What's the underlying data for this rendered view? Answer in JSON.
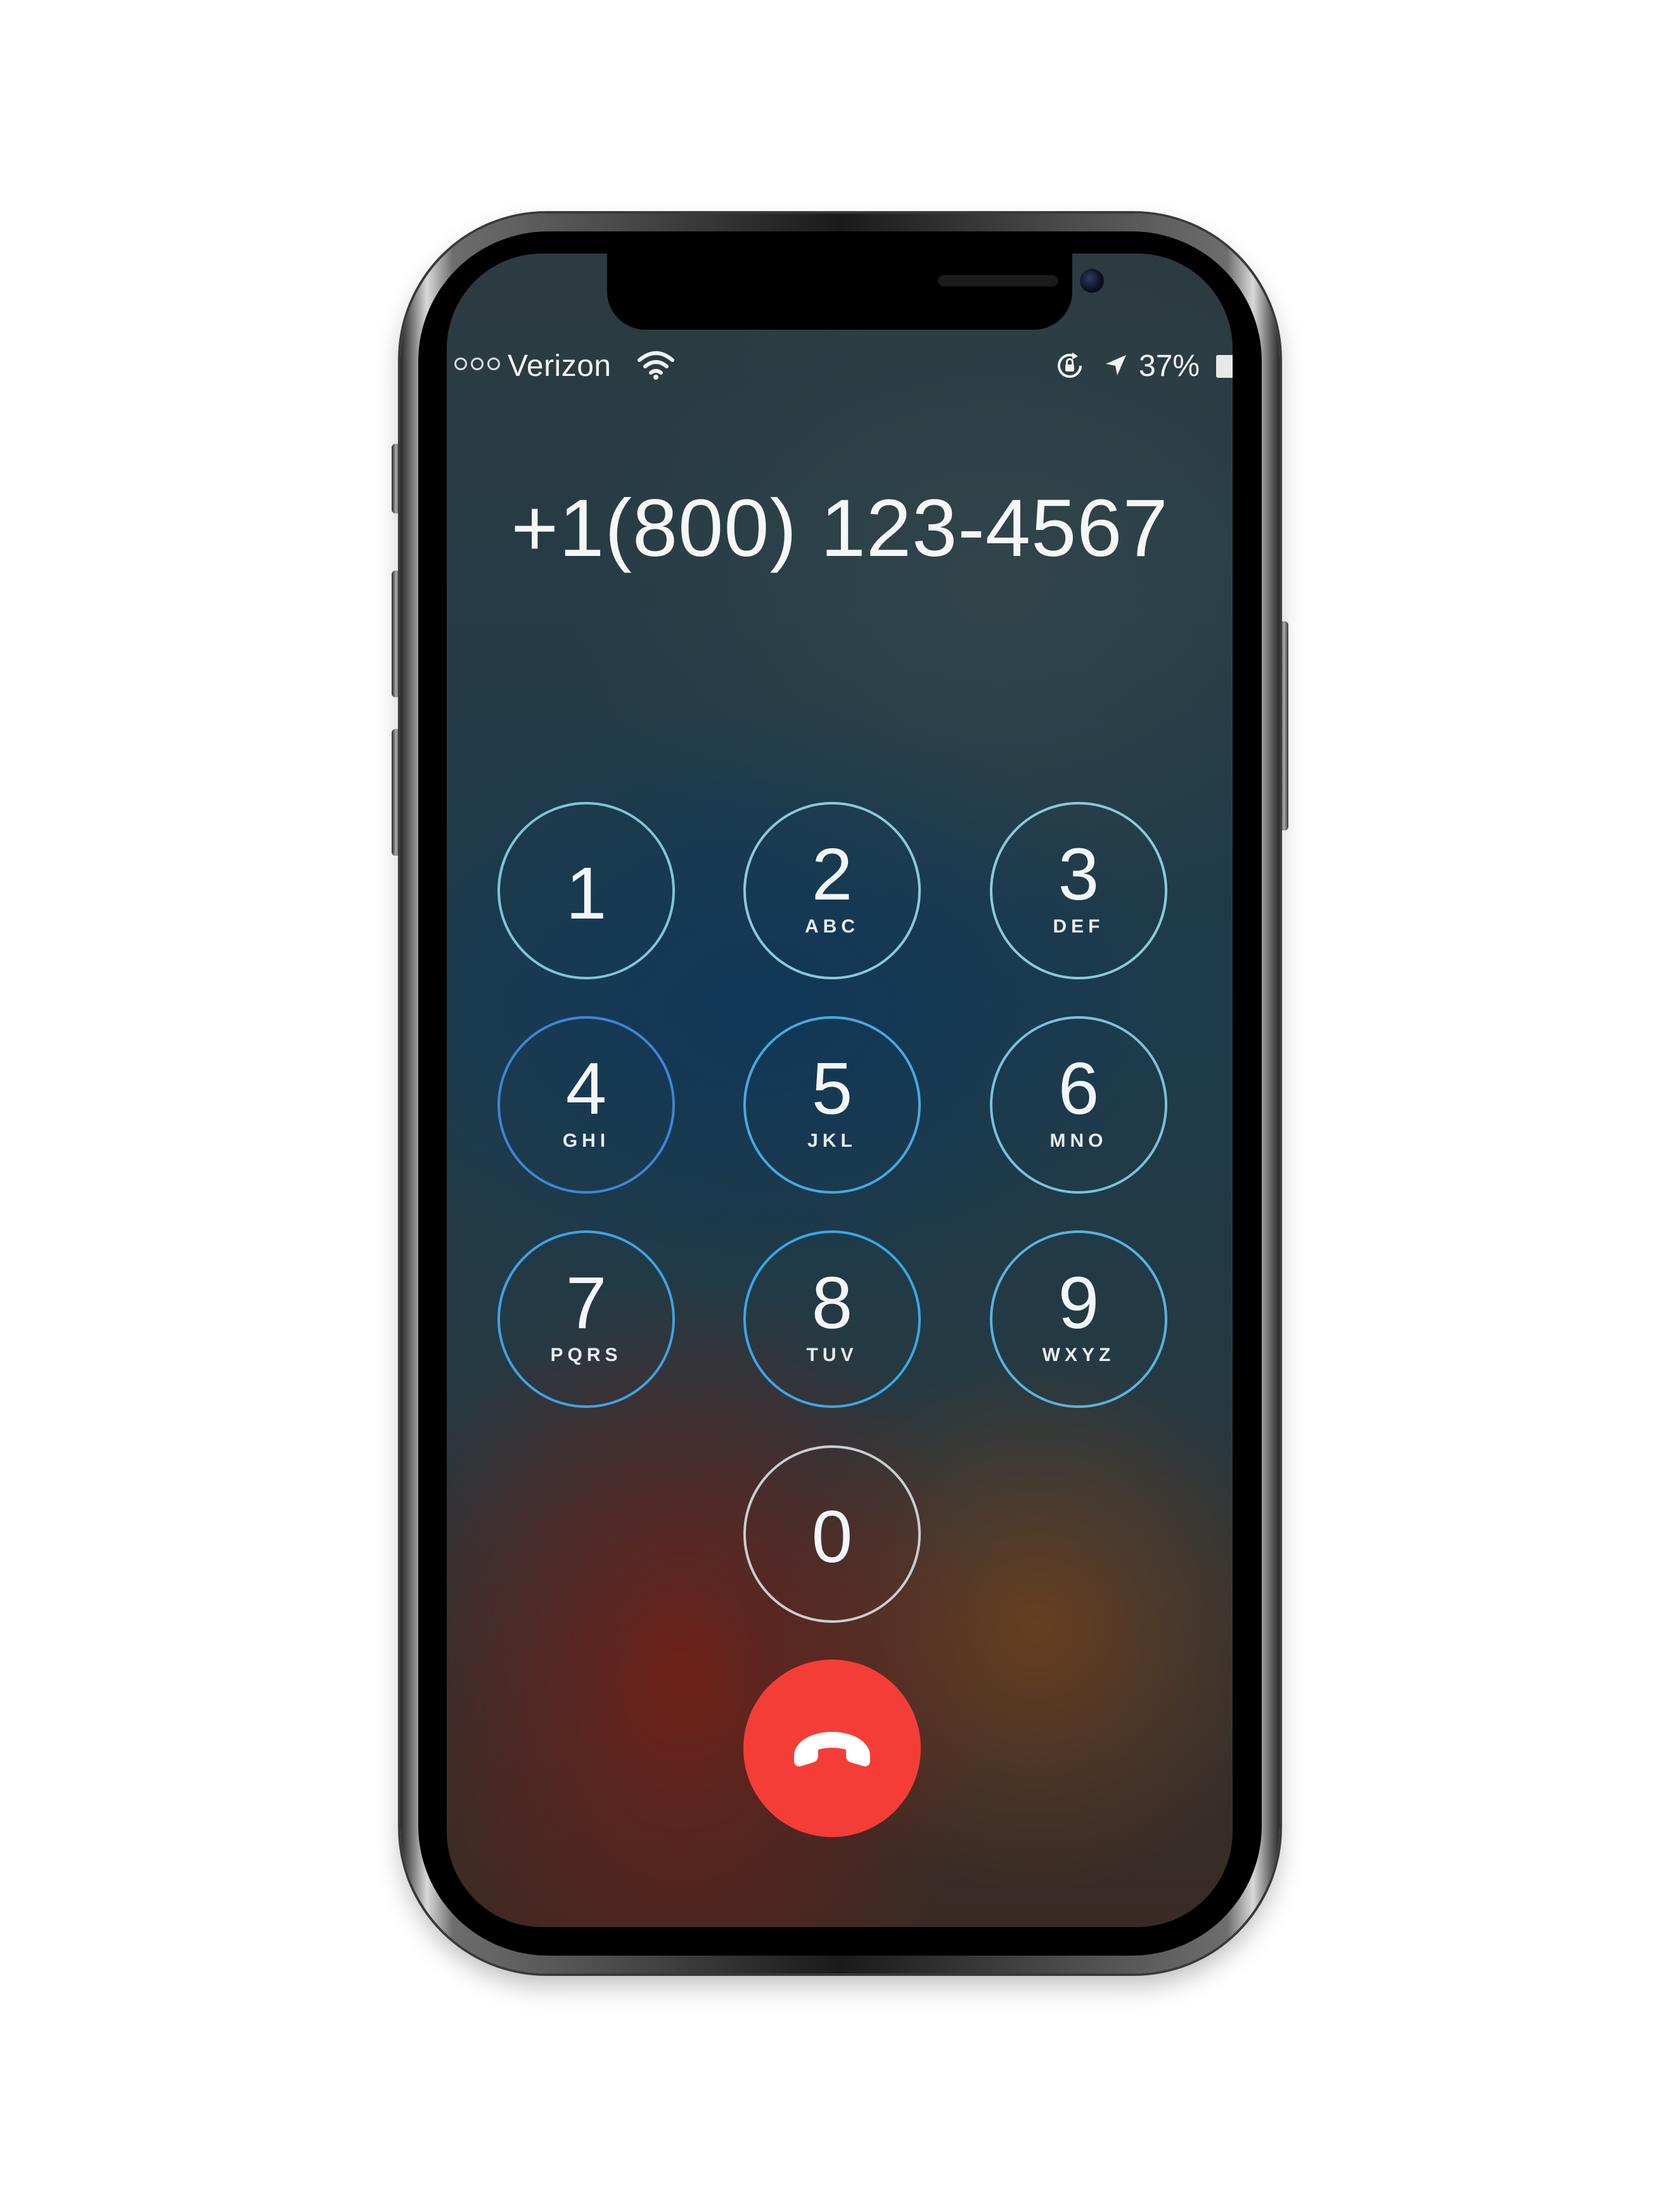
{
  "status_bar": {
    "carrier": "Verizon",
    "signal_bars_total": 3,
    "signal_bars_filled": 0,
    "battery_percent": "37%",
    "icons": [
      "wifi-icon",
      "orientation-lock-icon",
      "location-arrow-icon",
      "battery-icon"
    ]
  },
  "call": {
    "number": "+1(800) 123-4567"
  },
  "keypad": {
    "keys": [
      {
        "digit": "1",
        "letters": ""
      },
      {
        "digit": "2",
        "letters": "ABC"
      },
      {
        "digit": "3",
        "letters": "DEF"
      },
      {
        "digit": "4",
        "letters": "GHI"
      },
      {
        "digit": "5",
        "letters": "JKL"
      },
      {
        "digit": "6",
        "letters": "MNO"
      },
      {
        "digit": "7",
        "letters": "PQRS"
      },
      {
        "digit": "8",
        "letters": "TUV"
      },
      {
        "digit": "9",
        "letters": "WXYZ"
      },
      {
        "digit": "0",
        "letters": ""
      }
    ]
  },
  "end_call": {
    "icon": "hang-up-phone-icon",
    "color": "#f53d37"
  },
  "colors": {
    "key_ring_accent": "#49a9e0",
    "text": "#f4f6f7"
  }
}
